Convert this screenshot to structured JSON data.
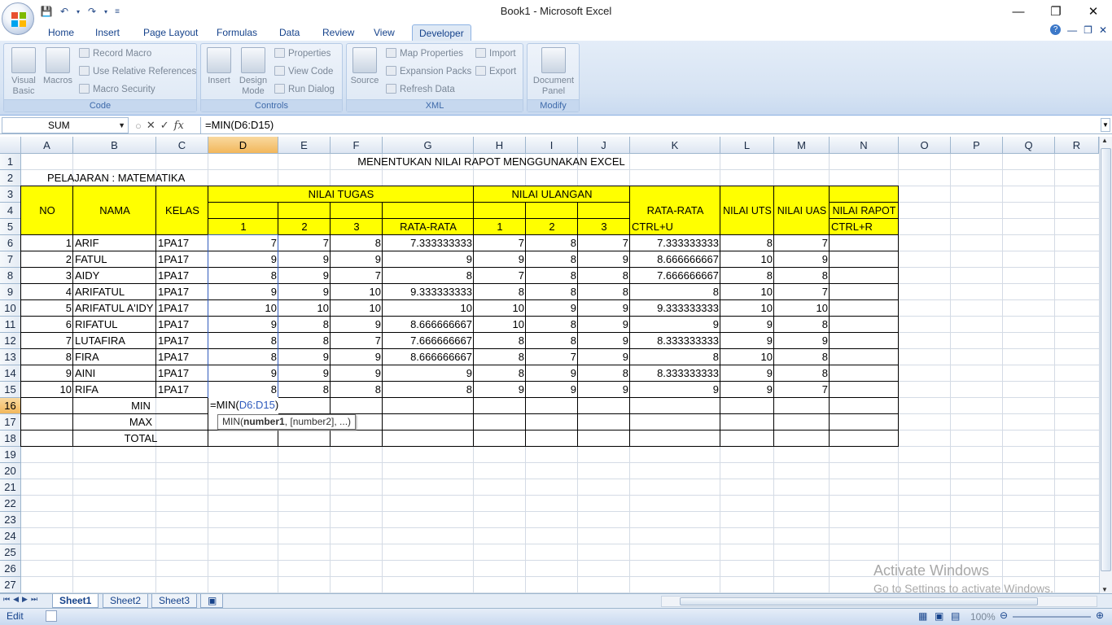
{
  "window": {
    "title": "Book1 - Microsoft Excel"
  },
  "ribbon": {
    "tabs": [
      "Home",
      "Insert",
      "Page Layout",
      "Formulas",
      "Data",
      "Review",
      "View",
      "Developer"
    ],
    "active_tab": "Developer",
    "groups": {
      "code": {
        "label": "Code",
        "visual_basic": "Visual Basic",
        "macros": "Macros",
        "record_macro": "Record Macro",
        "use_relative": "Use Relative References",
        "macro_security": "Macro Security"
      },
      "controls": {
        "label": "Controls",
        "insert": "Insert",
        "design_mode": "Design Mode",
        "properties": "Properties",
        "view_code": "View Code",
        "run_dialog": "Run Dialog"
      },
      "xml": {
        "label": "XML",
        "source": "Source",
        "map_properties": "Map Properties",
        "expansion_packs": "Expansion Packs",
        "refresh_data": "Refresh Data",
        "import": "Import",
        "export": "Export"
      },
      "modify": {
        "label": "Modify",
        "document_panel": "Document Panel"
      }
    }
  },
  "formula_bar": {
    "name_box": "SUM",
    "fx": "fx",
    "formula": "=MIN(D6:D15)"
  },
  "columns": [
    "A",
    "B",
    "C",
    "D",
    "E",
    "F",
    "G",
    "H",
    "I",
    "J",
    "K",
    "L",
    "M",
    "N",
    "O",
    "P",
    "Q",
    "R"
  ],
  "rows": [
    "1",
    "2",
    "3",
    "4",
    "5",
    "6",
    "7",
    "8",
    "9",
    "10",
    "11",
    "12",
    "13",
    "14",
    "15",
    "16",
    "17",
    "18",
    "19",
    "20",
    "21",
    "22",
    "23",
    "24",
    "25",
    "26",
    "27"
  ],
  "sheet": {
    "title": "MENENTUKAN NILAI RAPOT MENGGUNAKAN EXCEL",
    "subject": "PELAJARAN : MATEMATIKA",
    "headers": {
      "no": "NO",
      "nama": "NAMA",
      "kelas": "KELAS",
      "nilai_tugas": "NILAI TUGAS",
      "nilai_ulangan": "NILAI ULANGAN",
      "rata_rata": "RATA-RATA",
      "rata_rata_k": "RATA-RATA",
      "ctrl_u": "CTRL+U",
      "nilai_uts": "NILAI UTS",
      "nilai_uas": "NILAI UAS",
      "nilai_rapot": "NILAI RAPOT",
      "ctrl_r": "CTRL+R",
      "t1": "1",
      "t2": "2",
      "t3": "3",
      "u1": "1",
      "u2": "2",
      "u3": "3"
    },
    "data_rows": [
      [
        "1",
        "ARIF",
        "1PA17",
        "7",
        "7",
        "8",
        "7.333333333",
        "7",
        "8",
        "7",
        "7.333333333",
        "8",
        "7"
      ],
      [
        "2",
        "FATUL",
        "1PA17",
        "9",
        "9",
        "9",
        "9",
        "9",
        "8",
        "9",
        "8.666666667",
        "10",
        "9"
      ],
      [
        "3",
        "AIDY",
        "1PA17",
        "8",
        "9",
        "7",
        "8",
        "7",
        "8",
        "8",
        "7.666666667",
        "8",
        "8"
      ],
      [
        "4",
        "ARIFATUL",
        "1PA17",
        "9",
        "9",
        "10",
        "9.333333333",
        "8",
        "8",
        "8",
        "8",
        "10",
        "7"
      ],
      [
        "5",
        "ARIFATUL A'IDY",
        "1PA17",
        "10",
        "10",
        "10",
        "10",
        "10",
        "9",
        "9",
        "9.333333333",
        "10",
        "10"
      ],
      [
        "6",
        "RIFATUL",
        "1PA17",
        "9",
        "8",
        "9",
        "8.666666667",
        "10",
        "8",
        "9",
        "9",
        "9",
        "8"
      ],
      [
        "7",
        "LUTAFIRA",
        "1PA17",
        "8",
        "8",
        "7",
        "7.666666667",
        "8",
        "8",
        "9",
        "8.333333333",
        "9",
        "9"
      ],
      [
        "8",
        "FIRA",
        "1PA17",
        "8",
        "9",
        "9",
        "8.666666667",
        "8",
        "7",
        "9",
        "8",
        "10",
        "8"
      ],
      [
        "9",
        "AINI",
        "1PA17",
        "9",
        "9",
        "9",
        "9",
        "8",
        "9",
        "8",
        "8.333333333",
        "9",
        "8"
      ],
      [
        "10",
        "RIFA",
        "1PA17",
        "8",
        "8",
        "8",
        "8",
        "9",
        "9",
        "9",
        "9",
        "9",
        "7"
      ]
    ],
    "summary": {
      "min": "MIN",
      "max": "MAX",
      "total": "TOTAL"
    },
    "editing": {
      "prefix": "=MIN(",
      "range": "D6:D15",
      "suffix": ")"
    },
    "tooltip": {
      "fn": "MIN(",
      "arg1": "number1",
      "rest": ", [number2], ...)"
    }
  },
  "sheet_tabs": [
    "Sheet1",
    "Sheet2",
    "Sheet3"
  ],
  "active_sheet": "Sheet1",
  "status": {
    "mode": "Edit",
    "zoom": "100%"
  },
  "watermark": {
    "line1": "Activate Windows",
    "line2": "Go to Settings to activate Windows."
  },
  "colors": {
    "highlight": "#ffff00",
    "accent": "#15428b",
    "range_ref": "#2f5bbd"
  }
}
